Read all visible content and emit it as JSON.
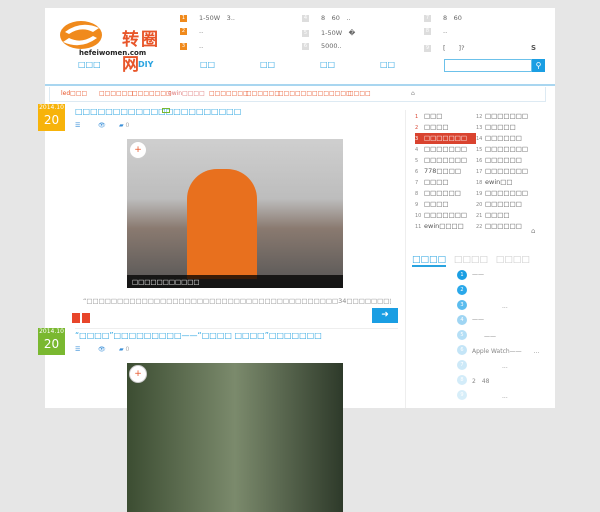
{
  "header": {
    "logo_text": "转圈网",
    "logo_sub": "hefeiwomen.com",
    "top_links": [
      [
        "1",
        "1-50W　3.."
      ],
      [
        "2",
        ".."
      ],
      [
        "3",
        ".."
      ],
      [
        "4",
        "8　60　.."
      ],
      [
        "5",
        "1-50W　�"
      ],
      [
        "6",
        "5000.."
      ],
      [
        "7",
        "8　60"
      ],
      [
        "8",
        ".."
      ],
      [
        "9",
        "[　　]?"
      ]
    ],
    "corner": "S"
  },
  "nav": [
    "□□□",
    "DIY",
    "□□",
    "□□",
    "□□",
    "□□"
  ],
  "search": {
    "placeholder": ""
  },
  "subnav": [
    "led□□□",
    "□□□□□□",
    "□□□□□□□",
    "ewin□□□□",
    "□□□□□□□",
    "□□□□□□",
    "□□□□□□",
    "□□□□□□□",
    "□□□□"
  ],
  "posts": [
    {
      "year": "2014.10",
      "day": "20",
      "badge_color": "#f7b30a",
      "title": "□□□□□□□□□□□□□□□□□□□□□□",
      "comments": "0",
      "caption": "□□□□□□□□□□□",
      "excerpt": "“□□□□□□□□□□□□□□□□□□□□□□□□□□□□□□□□□□□□□□□□□34□□□□□□□□□□□□□□□□□□□□□□□□□□□□□□□□□□□□□□□□□□□□□□□□□..."
    },
    {
      "year": "2014.10",
      "day": "20",
      "badge_color": "#7ab830",
      "title": "“□□□□”□□□□□□□□□——“□□□□ □□□□”□□□□□□□",
      "comments": "0"
    }
  ],
  "ranking": {
    "left": [
      [
        "1",
        "□□□"
      ],
      [
        "2",
        "□□□□"
      ],
      [
        "3",
        "□□□□□□□"
      ],
      [
        "4",
        "□□□□□□□"
      ],
      [
        "5",
        "□□□□□□□"
      ],
      [
        "6",
        "778□□□□"
      ],
      [
        "7",
        "□□□□"
      ],
      [
        "8",
        "□□□□□□"
      ],
      [
        "9",
        "□□□□"
      ],
      [
        "10",
        "□□□□□□□"
      ],
      [
        "11",
        "ewin□□□□"
      ]
    ],
    "right": [
      [
        "12",
        "□□□□□□□"
      ],
      [
        "13",
        "□□□□□"
      ],
      [
        "14",
        "□□□□□□"
      ],
      [
        "15",
        "□□□□□□□"
      ],
      [
        "16",
        "□□□□□□"
      ],
      [
        "17",
        "□□□□□□□"
      ],
      [
        "18",
        "ewin□□"
      ],
      [
        "19",
        "□□□□□□□"
      ],
      [
        "20",
        "□□□□□□"
      ],
      [
        "21",
        "□□□□"
      ],
      [
        "22",
        "□□□□□□"
      ]
    ],
    "active": "3"
  },
  "tabs": [
    "□□□□",
    "□□□□",
    "□□□□"
  ],
  "latest": [
    [
      "1",
      "——"
    ],
    [
      "2",
      ""
    ],
    [
      "3",
      "　　　　　..."
    ],
    [
      "4",
      "——"
    ],
    [
      "5",
      "　　——"
    ],
    [
      "6",
      "Apple Watch——　　..."
    ],
    [
      "7",
      "　　　　　..."
    ],
    [
      "8",
      "2　48"
    ],
    [
      "9",
      "　　　　　..."
    ]
  ]
}
